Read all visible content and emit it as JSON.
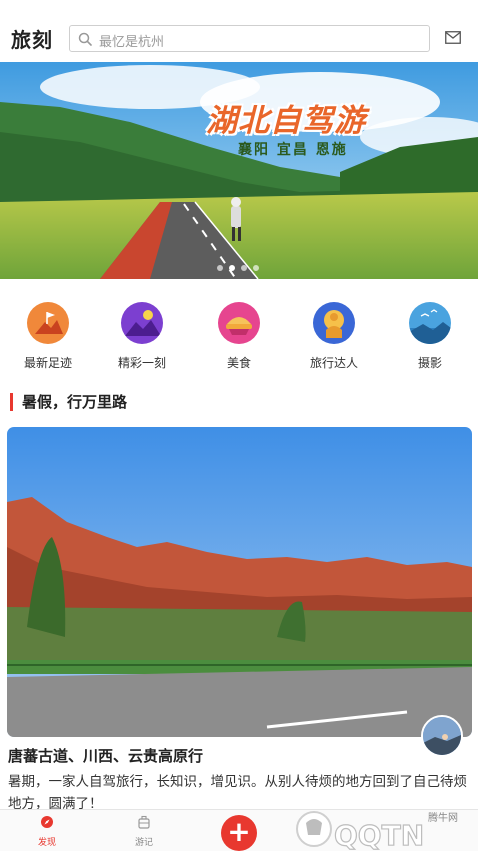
{
  "header": {
    "logo_text": "旅刻",
    "search_placeholder": "最忆是杭州"
  },
  "banner": {
    "title": "湖北自驾游",
    "subtitle": "襄阳 宜昌 恩施",
    "dots": 4,
    "active_dot": 2
  },
  "categories": [
    {
      "label": "最新足迹",
      "icon": "flag-mountain-icon",
      "color": "#f0883a"
    },
    {
      "label": "精彩一刻",
      "icon": "moon-night-icon",
      "color": "#7c3fd0"
    },
    {
      "label": "美食",
      "icon": "food-bowl-icon",
      "color": "#e6458f"
    },
    {
      "label": "旅行达人",
      "icon": "traveler-icon",
      "color": "#3a67d6"
    },
    {
      "label": "摄影",
      "icon": "landscape-photo-icon",
      "color": "#4aa3df"
    }
  ],
  "section": {
    "title": "暑假，行万里路"
  },
  "card": {
    "title": "唐蕃古道、川西、云贵高原行",
    "description": "暑期，一家人自驾旅行，长知识，增见识。从别人待烦的地方回到了自己待烦地方，圆满了！"
  },
  "tabbar": {
    "discover_label": "发现",
    "journal_label": "游记",
    "add_label": "+"
  },
  "watermark": {
    "text": "QQTN",
    "sub": "腾牛网"
  }
}
